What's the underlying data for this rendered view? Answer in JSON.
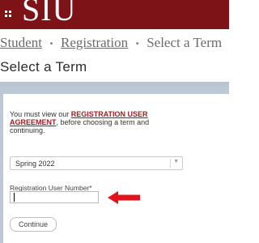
{
  "header": {
    "logo_text": "SIU",
    "brand_color": "#7d1217",
    "menu_icon": "menu-grid-icon"
  },
  "breadcrumb": {
    "items": [
      "Student",
      "Registration",
      "Select a Term"
    ],
    "separator": "•"
  },
  "page": {
    "title": "Select a Term"
  },
  "form": {
    "notice_prefix": "You must view our ",
    "agreement_link": "REGISTRATION USER AGREEMENT",
    "notice_suffix": ", before choosing a term and continuing.",
    "term_select_value": "Spring 2022",
    "reg_number_label": "Registration User Number*",
    "reg_number_value": "",
    "continue_label": "Continue"
  },
  "annotation": {
    "arrow_icon": "red-arrow-left-icon",
    "arrow_color": "#e0141b"
  }
}
